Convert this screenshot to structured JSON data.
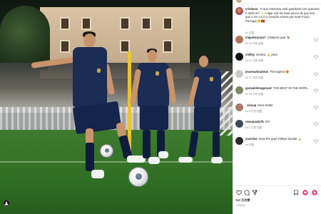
{
  "post": {
    "caption": {
      "user": "cristiano",
      "text": "O que interessa está guardado nos quarenta e tamb em ✨ A ligar nós há mais pouco de que tem que o em o ti ti o coração vamos por mais Força Portugal ✊🇵🇹",
      "meta": "6d 回复"
    },
    "comments": [
      {
        "user": "miguelzaraza7",
        "text": "Cristiano goat 🐐",
        "meta": "6d 90 次赞 回复",
        "avatar_color": "#b5725a"
      },
      {
        "user": "chilley",
        "text": "londrac 🙏 para",
        "meta": "6d 87 次赞 回复",
        "avatar_color": "#111111"
      },
      {
        "user": "jeanmarknatinal",
        "text": "The legend 😍",
        "meta": "6d 32 次赞 回复",
        "avatar_color": "#c9c9c9"
      },
      {
        "user": "gonzalobraganca0",
        "text": "THE BEST IN THE WORLD 🏆",
        "meta": "6d 58 次赞 回复",
        "avatar_color": "#7c8a5c"
      },
      {
        "user": "_zizuup",
        "text": "there better",
        "meta": "6d 8 次赞 回复",
        "avatar_color": "#a77a67"
      },
      {
        "user": "neaopaulp7b",
        "text": "GO",
        "meta": "6d 2 次赞 回复",
        "avatar_color": "#3b4a5c"
      },
      {
        "user": "yasmine",
        "text": "keep the goal Türkiye kandar 🙏",
        "meta": "6d 回复",
        "avatar_color": "#2a2a2a"
      }
    ],
    "likes": "9,0 万次赞",
    "date": "12月4日"
  },
  "icons": {
    "like": "heart-icon",
    "comment": "comment-icon",
    "share": "share-icon",
    "save": "bookmark-icon",
    "tag": "person-tag-icon"
  },
  "colors": {
    "accent": "#e1306c",
    "muted": "#8e8e8e",
    "text": "#262626"
  }
}
